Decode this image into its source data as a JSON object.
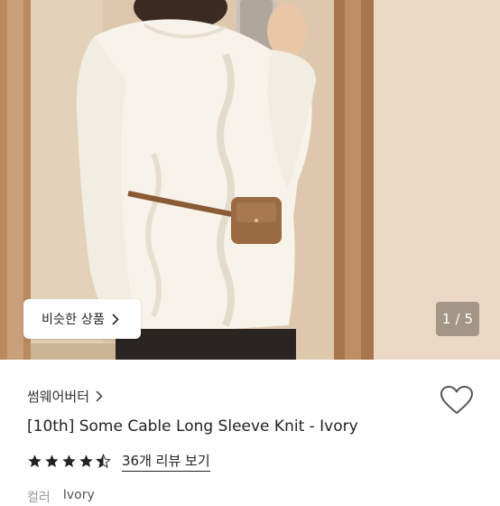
{
  "hero": {
    "similar_button_label": "비슷한 상품",
    "pager": {
      "current": "1",
      "separator": "/",
      "total": "5"
    }
  },
  "product": {
    "brand": "썸웨어버터",
    "title": "[10th] Some Cable Long Sleeve Knit - Ivory",
    "rating": 4.5,
    "review_link": "36개 리뷰 보기",
    "option_label": "컬러",
    "option_value": "Ivory"
  },
  "icons": {
    "similar_chevron": "chevron-right-icon",
    "brand_chevron": "chevron-right-icon",
    "wishlist": "heart-outline-icon",
    "star": "star-icon"
  },
  "colors": {
    "star": "#222222",
    "heart_stroke": "#555555",
    "pager_bg": "rgba(80,70,60,0.45)"
  }
}
